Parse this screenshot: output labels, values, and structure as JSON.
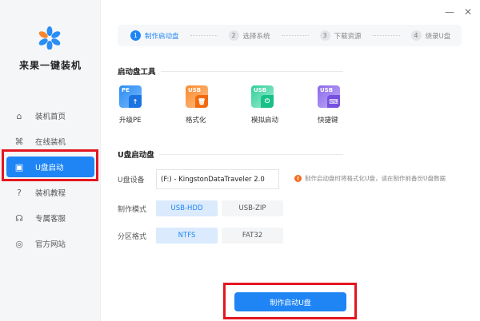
{
  "app": {
    "brand": "来果一键装机",
    "minimize": "—",
    "close": "✕"
  },
  "sidebar": {
    "items": [
      {
        "label": "装机首页",
        "icon": "home-icon",
        "glyph": "⌂"
      },
      {
        "label": "在线装机",
        "icon": "online-icon",
        "glyph": "⌘"
      },
      {
        "label": "U盘启动",
        "icon": "usb-icon",
        "glyph": "▣"
      },
      {
        "label": "装机教程",
        "icon": "help-icon",
        "glyph": "?"
      },
      {
        "label": "专属客服",
        "icon": "headset-icon",
        "glyph": "☊"
      },
      {
        "label": "官方网站",
        "icon": "browser-icon",
        "glyph": "◎"
      }
    ],
    "active_index": 2
  },
  "steps": [
    {
      "num": "1",
      "label": "制作启动盘"
    },
    {
      "num": "2",
      "label": "选择系统"
    },
    {
      "num": "3",
      "label": "下载资源"
    },
    {
      "num": "4",
      "label": "烧录U盘"
    }
  ],
  "tools": {
    "title": "启动盘工具",
    "items": [
      {
        "tag": "PE",
        "label": "升级PE",
        "glyph": "↑",
        "color": "#2a8cf5"
      },
      {
        "tag": "USB",
        "label": "格式化",
        "glyph": "🗑",
        "color": "#fb8a2c"
      },
      {
        "tag": "USB",
        "label": "模拟启动",
        "glyph": "⏻",
        "color": "#2fcf9a"
      },
      {
        "tag": "USB",
        "label": "快捷键",
        "glyph": "⌨",
        "color": "#8b68ea"
      }
    ]
  },
  "usb": {
    "title": "U盘启动盘",
    "device_label": "U盘设备",
    "device_value": "(F:) - KingstonDataTraveler 2.0",
    "warning": "制作启动盘时将格式化U盘，请在制作前备份U盘数据",
    "mode_label": "制作模式",
    "modes": [
      "USB-HDD",
      "USB-ZIP"
    ],
    "part_label": "分区格式",
    "parts": [
      "NTFS",
      "FAT32"
    ],
    "button": "制作启动U盘"
  }
}
